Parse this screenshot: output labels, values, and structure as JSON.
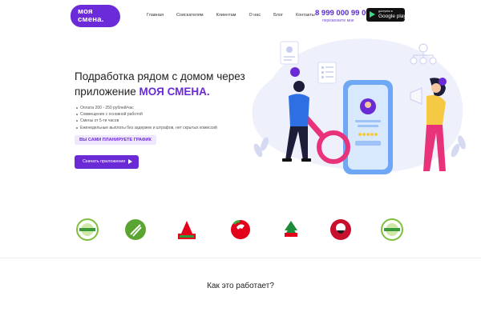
{
  "header": {
    "logo_line1": "моя",
    "logo_line2": "смена.",
    "nav": [
      "Главная",
      "Соискателям",
      "Клиентам",
      "О нас",
      "Блог",
      "Контакты"
    ],
    "phone": "8 999 000 99 00",
    "callback": "перезвоните мне",
    "store_small": "доступно в",
    "store_big": "Google play"
  },
  "hero": {
    "title_part1": "Подработка рядом с домом через приложение ",
    "title_brand": "МОЯ СМЕНА.",
    "bullets": [
      "Оплата 200 - 250 рублей/час",
      "Совмещение с основной работой",
      "Смены от 5-ти часов",
      "Еженедельные выплаты без задержек и штрафов, нет скрытых комиссий"
    ],
    "badge": "ВЫ САМИ ПЛАНИРУЕТЕ ГРАФИК",
    "download_label": "Скачать приложение"
  },
  "partners": [
    {
      "name": "Зелёный логотип 1"
    },
    {
      "name": "Зелёный логотип 2"
    },
    {
      "name": "Ашан"
    },
    {
      "name": "Пятёрочка"
    },
    {
      "name": "SPAR"
    },
    {
      "name": "KFC"
    },
    {
      "name": "Зелёный логотип 3"
    }
  ],
  "how_it_works": {
    "title": "Как это работает?"
  },
  "colors": {
    "brand": "#6a2bd6",
    "accent_pink": "#e8337a",
    "accent_yellow": "#f6c945"
  }
}
